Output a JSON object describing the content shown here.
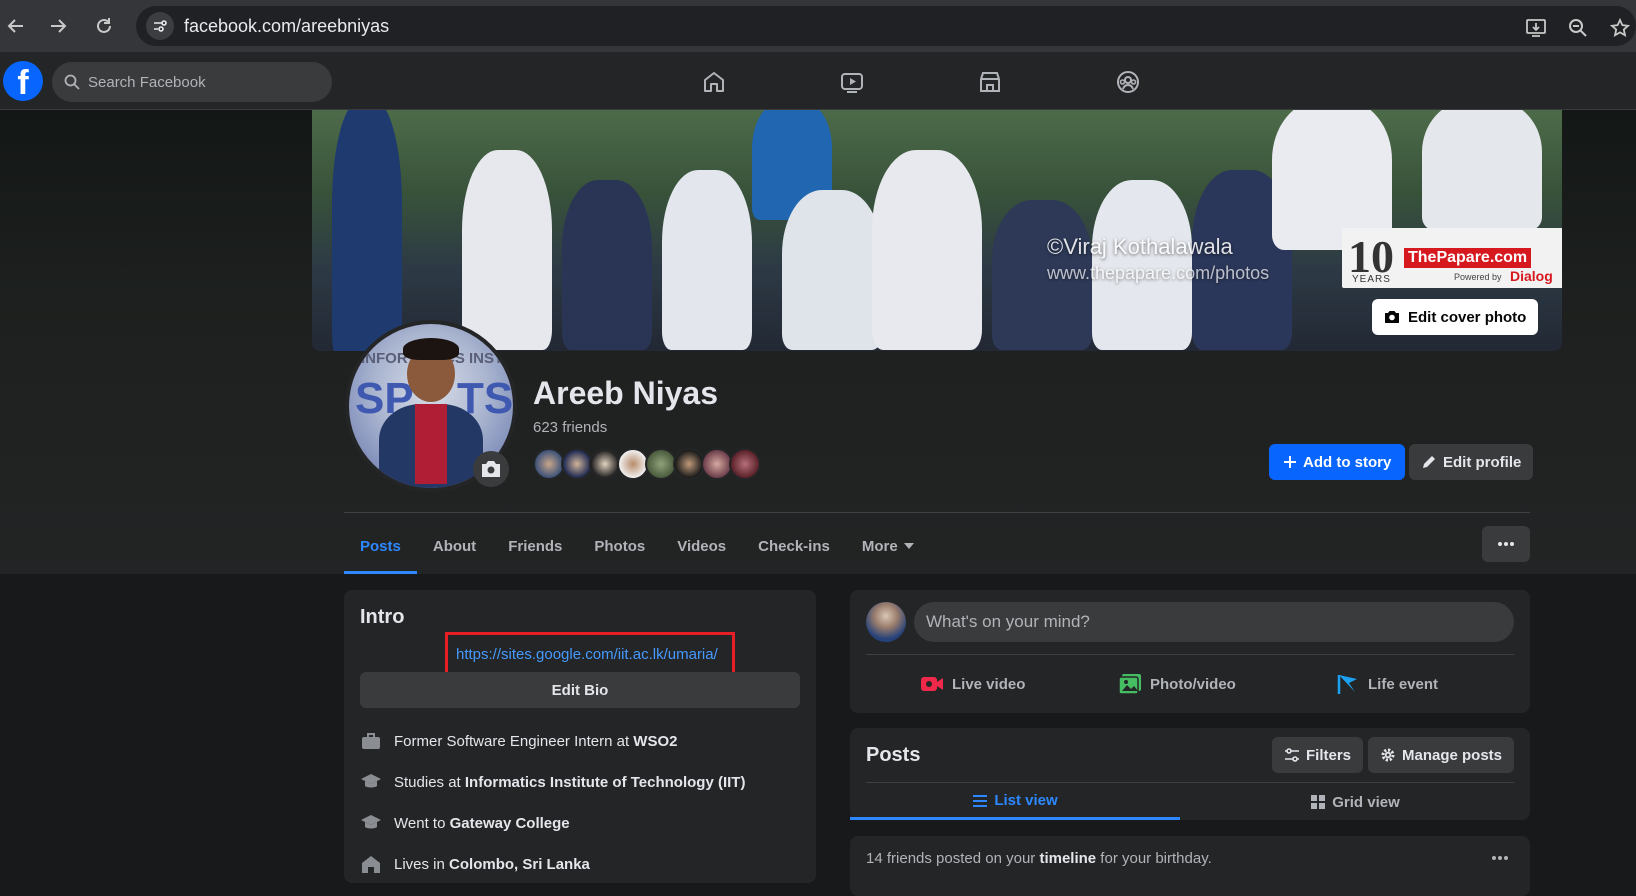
{
  "browser": {
    "url": "facebook.com/areebniyas"
  },
  "fb_nav": {
    "logo_letter": "f",
    "search_placeholder": "Search Facebook",
    "icons": [
      "home-icon",
      "video-icon",
      "marketplace-icon",
      "groups-icon"
    ]
  },
  "cover": {
    "watermark_credit": "©Viraj Kothalawala",
    "watermark_url": "www.thepapare.com/photos",
    "logo_number": "10",
    "logo_years": "YEARS",
    "logo_name": "ThePapare.com",
    "logo_powered": "Powered by",
    "logo_sponsor": "Dialog",
    "edit_button": "Edit cover photo",
    "avatar_bg_text_1": "INFOR",
    "avatar_bg_text_2": "CS INST",
    "avatar_bg_text_3": "SP",
    "avatar_bg_text_4": "TS"
  },
  "profile": {
    "name": "Areeb Niyas",
    "friends": "623 friends",
    "add_story": "Add to story",
    "edit_profile": "Edit profile"
  },
  "tabs": {
    "items": [
      "Posts",
      "About",
      "Friends",
      "Photos",
      "Videos",
      "Check-ins",
      "More"
    ],
    "active": "Posts"
  },
  "intro": {
    "title": "Intro",
    "bio_link": "https://sites.google.com/iit.ac.lk/umaria/",
    "edit_bio": "Edit Bio",
    "items": [
      {
        "prefix": "Former Software Engineer Intern at ",
        "bold": "WSO2"
      },
      {
        "prefix": "Studies at ",
        "bold": "Informatics Institute of Technology (IIT)"
      },
      {
        "prefix": "Went to ",
        "bold": "Gateway College"
      },
      {
        "prefix": "Lives in ",
        "bold": "Colombo, Sri Lanka"
      }
    ]
  },
  "composer": {
    "placeholder": "What's on your mind?",
    "live_video": "Live video",
    "photo_video": "Photo/video",
    "life_event": "Life event"
  },
  "posts": {
    "title": "Posts",
    "filters": "Filters",
    "manage_posts": "Manage posts",
    "list_view": "List view",
    "grid_view": "Grid view"
  },
  "birthday": {
    "prefix": "14 friends posted on your ",
    "bold": "timeline",
    "suffix": " for your birthday."
  },
  "colors": {
    "accent": "#0866ff",
    "link": "#4599ff",
    "highlight_box": "#e51f25",
    "surface": "#242526",
    "background": "#18191a"
  }
}
